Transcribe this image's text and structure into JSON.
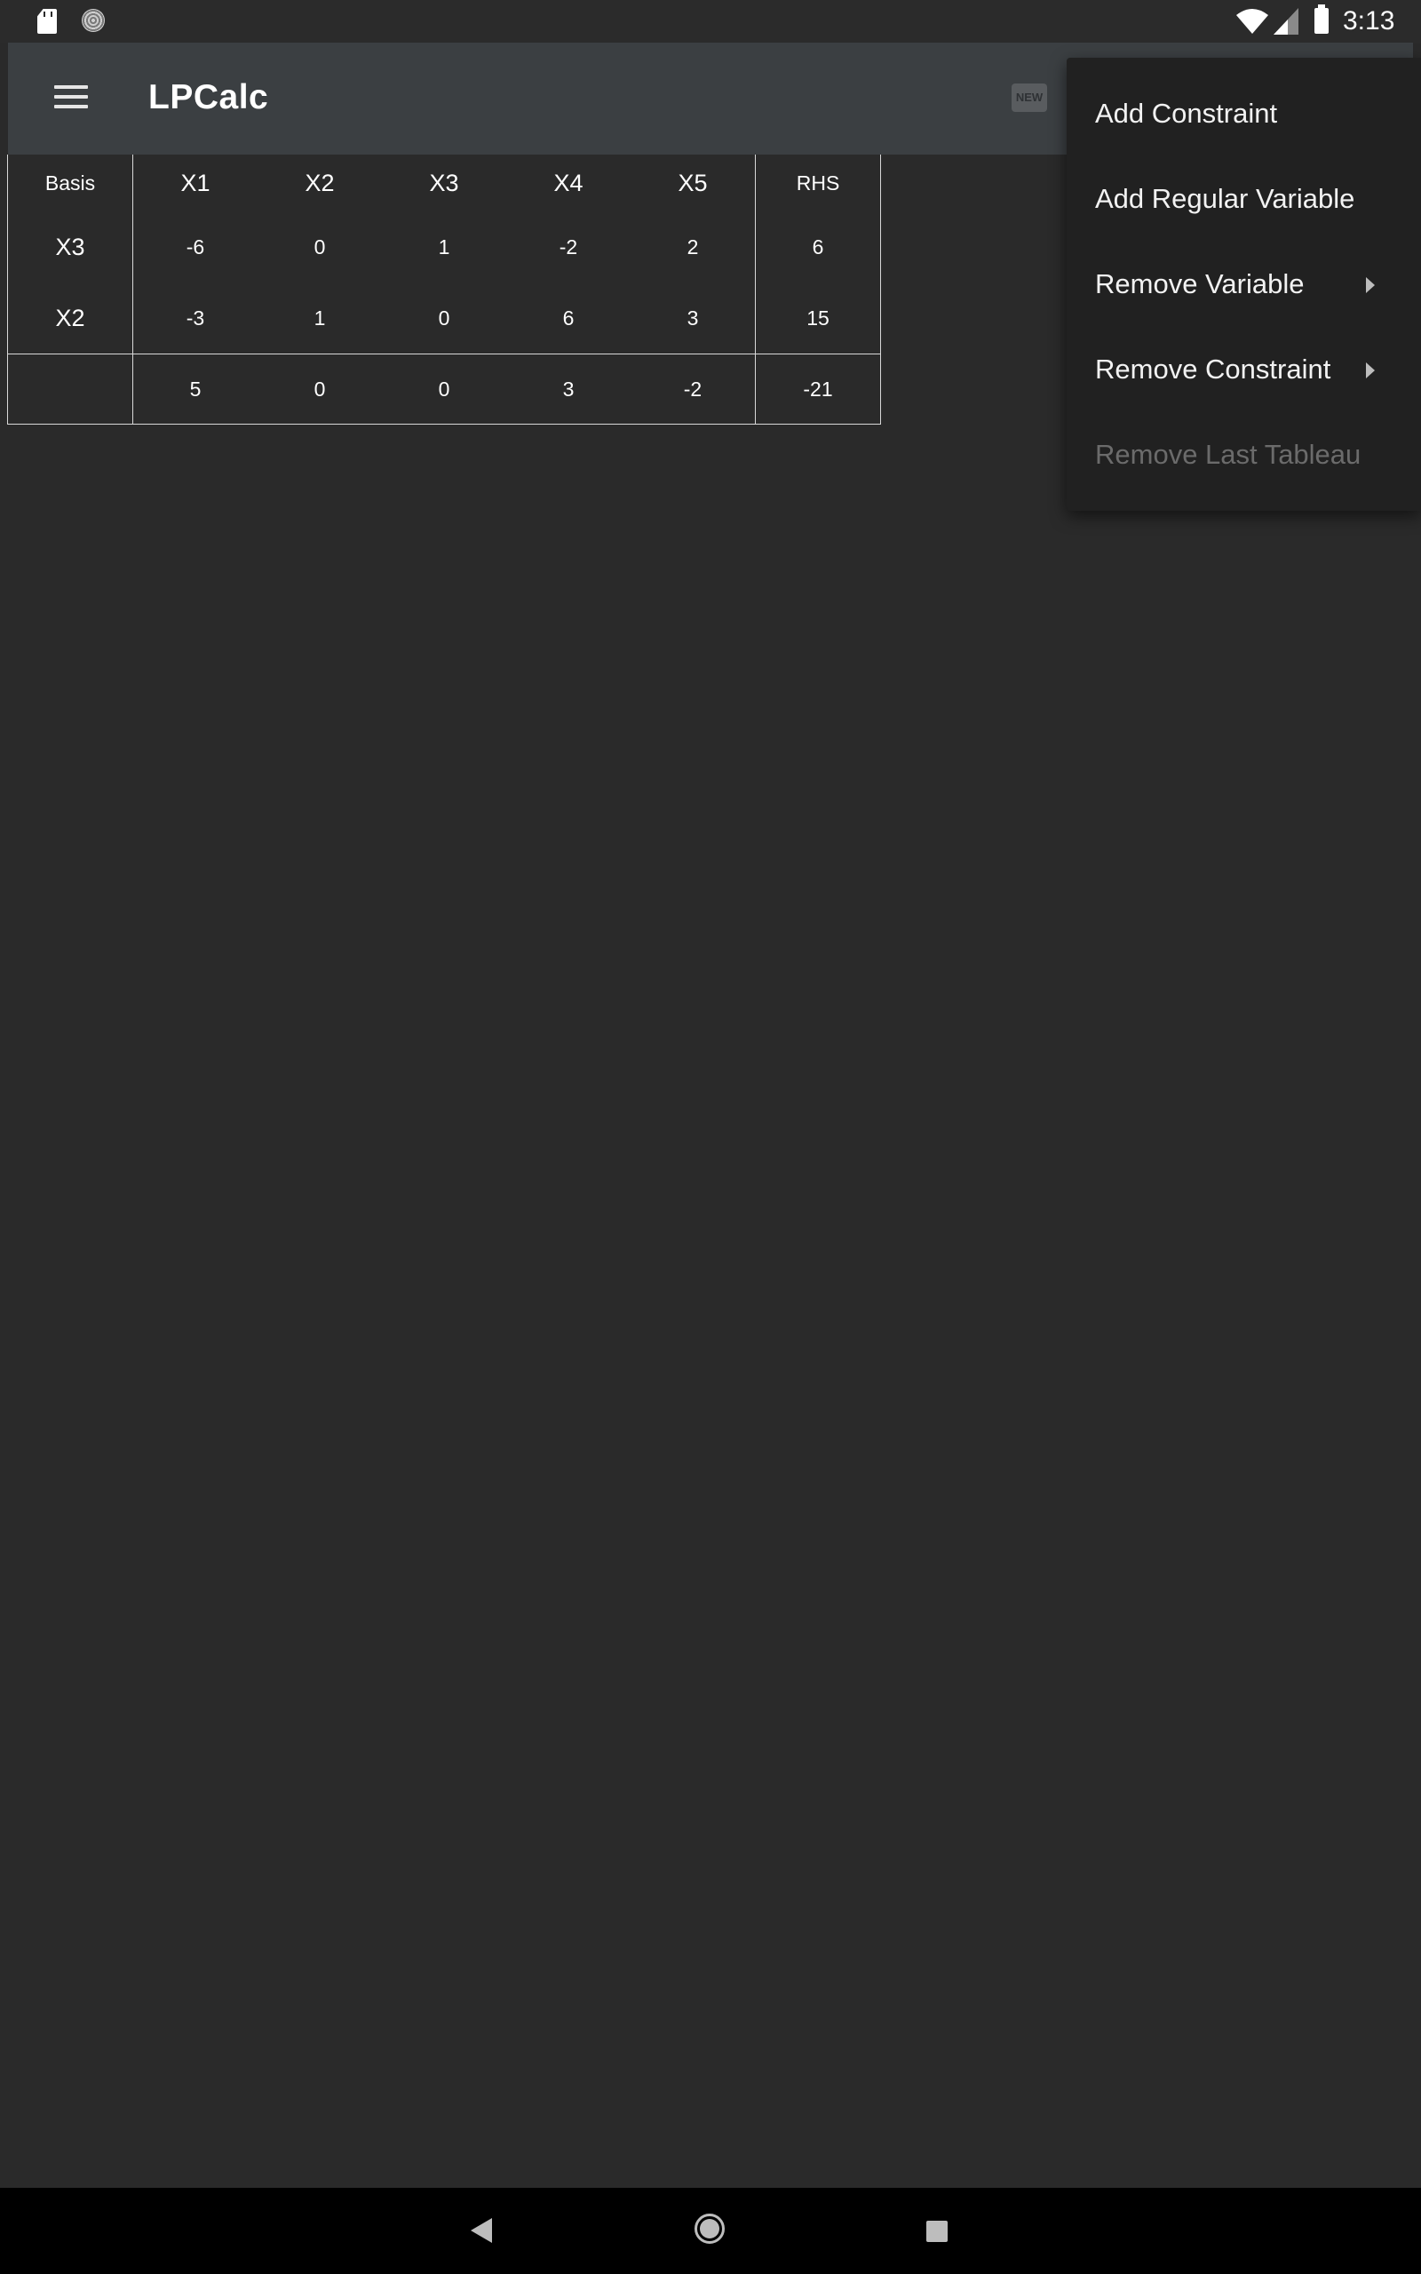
{
  "status_bar": {
    "time": "3:13",
    "icons": [
      "sd-card-icon",
      "sync-icon",
      "wifi-icon",
      "signal-icon",
      "battery-icon"
    ]
  },
  "toolbar": {
    "title": "LPCalc",
    "new_badge": "NEW",
    "icons": [
      "menu-icon",
      "new-icon"
    ]
  },
  "tableau": {
    "headers": [
      "Basis",
      "X1",
      "X2",
      "X3",
      "X4",
      "X5",
      "RHS"
    ],
    "rows": [
      {
        "basis": "X3",
        "values": [
          "-6",
          "0",
          "1",
          "-2",
          "2"
        ],
        "rhs": "6"
      },
      {
        "basis": "X2",
        "values": [
          "-3",
          "1",
          "0",
          "6",
          "3"
        ],
        "rhs": "15"
      }
    ],
    "objective": {
      "basis": "",
      "values": [
        "5",
        "0",
        "0",
        "3",
        "-2"
      ],
      "rhs": "-21"
    }
  },
  "overflow_menu": {
    "items": [
      {
        "label": "Add Constraint",
        "enabled": true,
        "has_submenu": false
      },
      {
        "label": "Add Regular Variable",
        "enabled": true,
        "has_submenu": false
      },
      {
        "label": "Remove Variable",
        "enabled": true,
        "has_submenu": true
      },
      {
        "label": "Remove Constraint",
        "enabled": true,
        "has_submenu": true
      },
      {
        "label": "Remove Last Tableau",
        "enabled": false,
        "has_submenu": false
      }
    ]
  },
  "nav_bar": {
    "icons": [
      "back-icon",
      "home-icon",
      "recents-icon"
    ]
  },
  "colors": {
    "background": "#2a2a2a",
    "toolbar": "#3b3f42",
    "menu": "#212121",
    "disabled_text": "#6b6b6b",
    "grid_lines": "#d8d8d8"
  }
}
